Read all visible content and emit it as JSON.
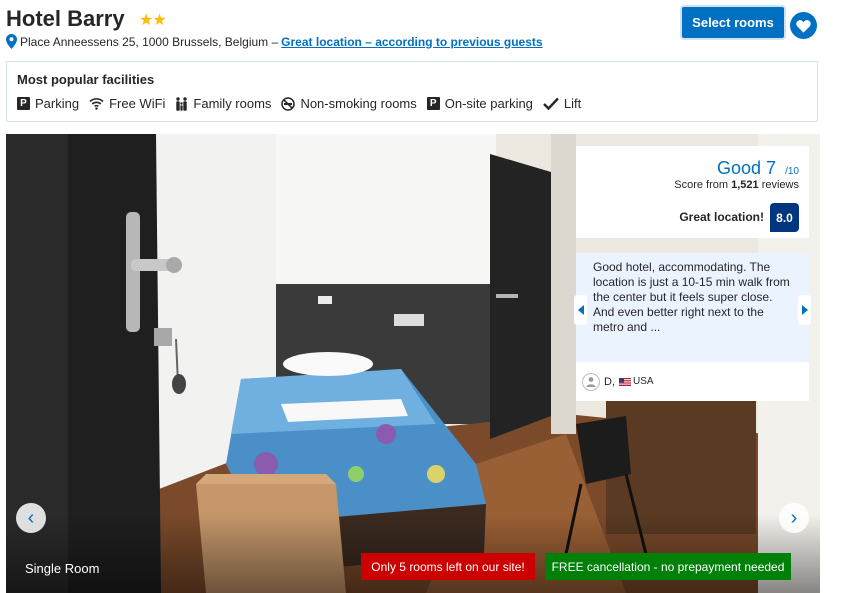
{
  "hotel": {
    "name": "Hotel Barry",
    "stars": "★★",
    "address": "Place Anneessens 25, 1000 Brussels, Belgium –",
    "location_link": "Great location – according to previous guests"
  },
  "actions": {
    "select_rooms": "Select rooms"
  },
  "facilities": {
    "title": "Most popular facilities",
    "items": [
      {
        "label": "Parking",
        "icon": "parking-icon"
      },
      {
        "label": "Free WiFi",
        "icon": "wifi-icon"
      },
      {
        "label": "Family rooms",
        "icon": "family-icon"
      },
      {
        "label": "Non-smoking rooms",
        "icon": "no-smoking-icon"
      },
      {
        "label": "On-site parking",
        "icon": "parking-icon"
      },
      {
        "label": "Lift",
        "icon": "check-icon"
      }
    ]
  },
  "gallery": {
    "room_label": "Single Room",
    "prev": "‹",
    "next": "›",
    "urgency": "Only 5 rooms left on our site!",
    "cancellation": "FREE cancellation - no prepayment needed"
  },
  "score": {
    "word": "Good 7",
    "max": "/10",
    "from": "Score from",
    "count": "1,521",
    "reviews": "reviews",
    "location_label": "Great location!",
    "location_score": "8.0"
  },
  "review": {
    "text": "Good hotel, accommodating. The location is just a 10-15 min walk from the center but it feels super close. And even better right next to the metro and ...",
    "reviewer": "D,",
    "country": "USA"
  },
  "colors": {
    "brand_blue": "#0071c2",
    "dark_blue": "#003580",
    "star_yellow": "#febb02",
    "urgency_red": "#cc0000",
    "success_green": "#008009"
  }
}
